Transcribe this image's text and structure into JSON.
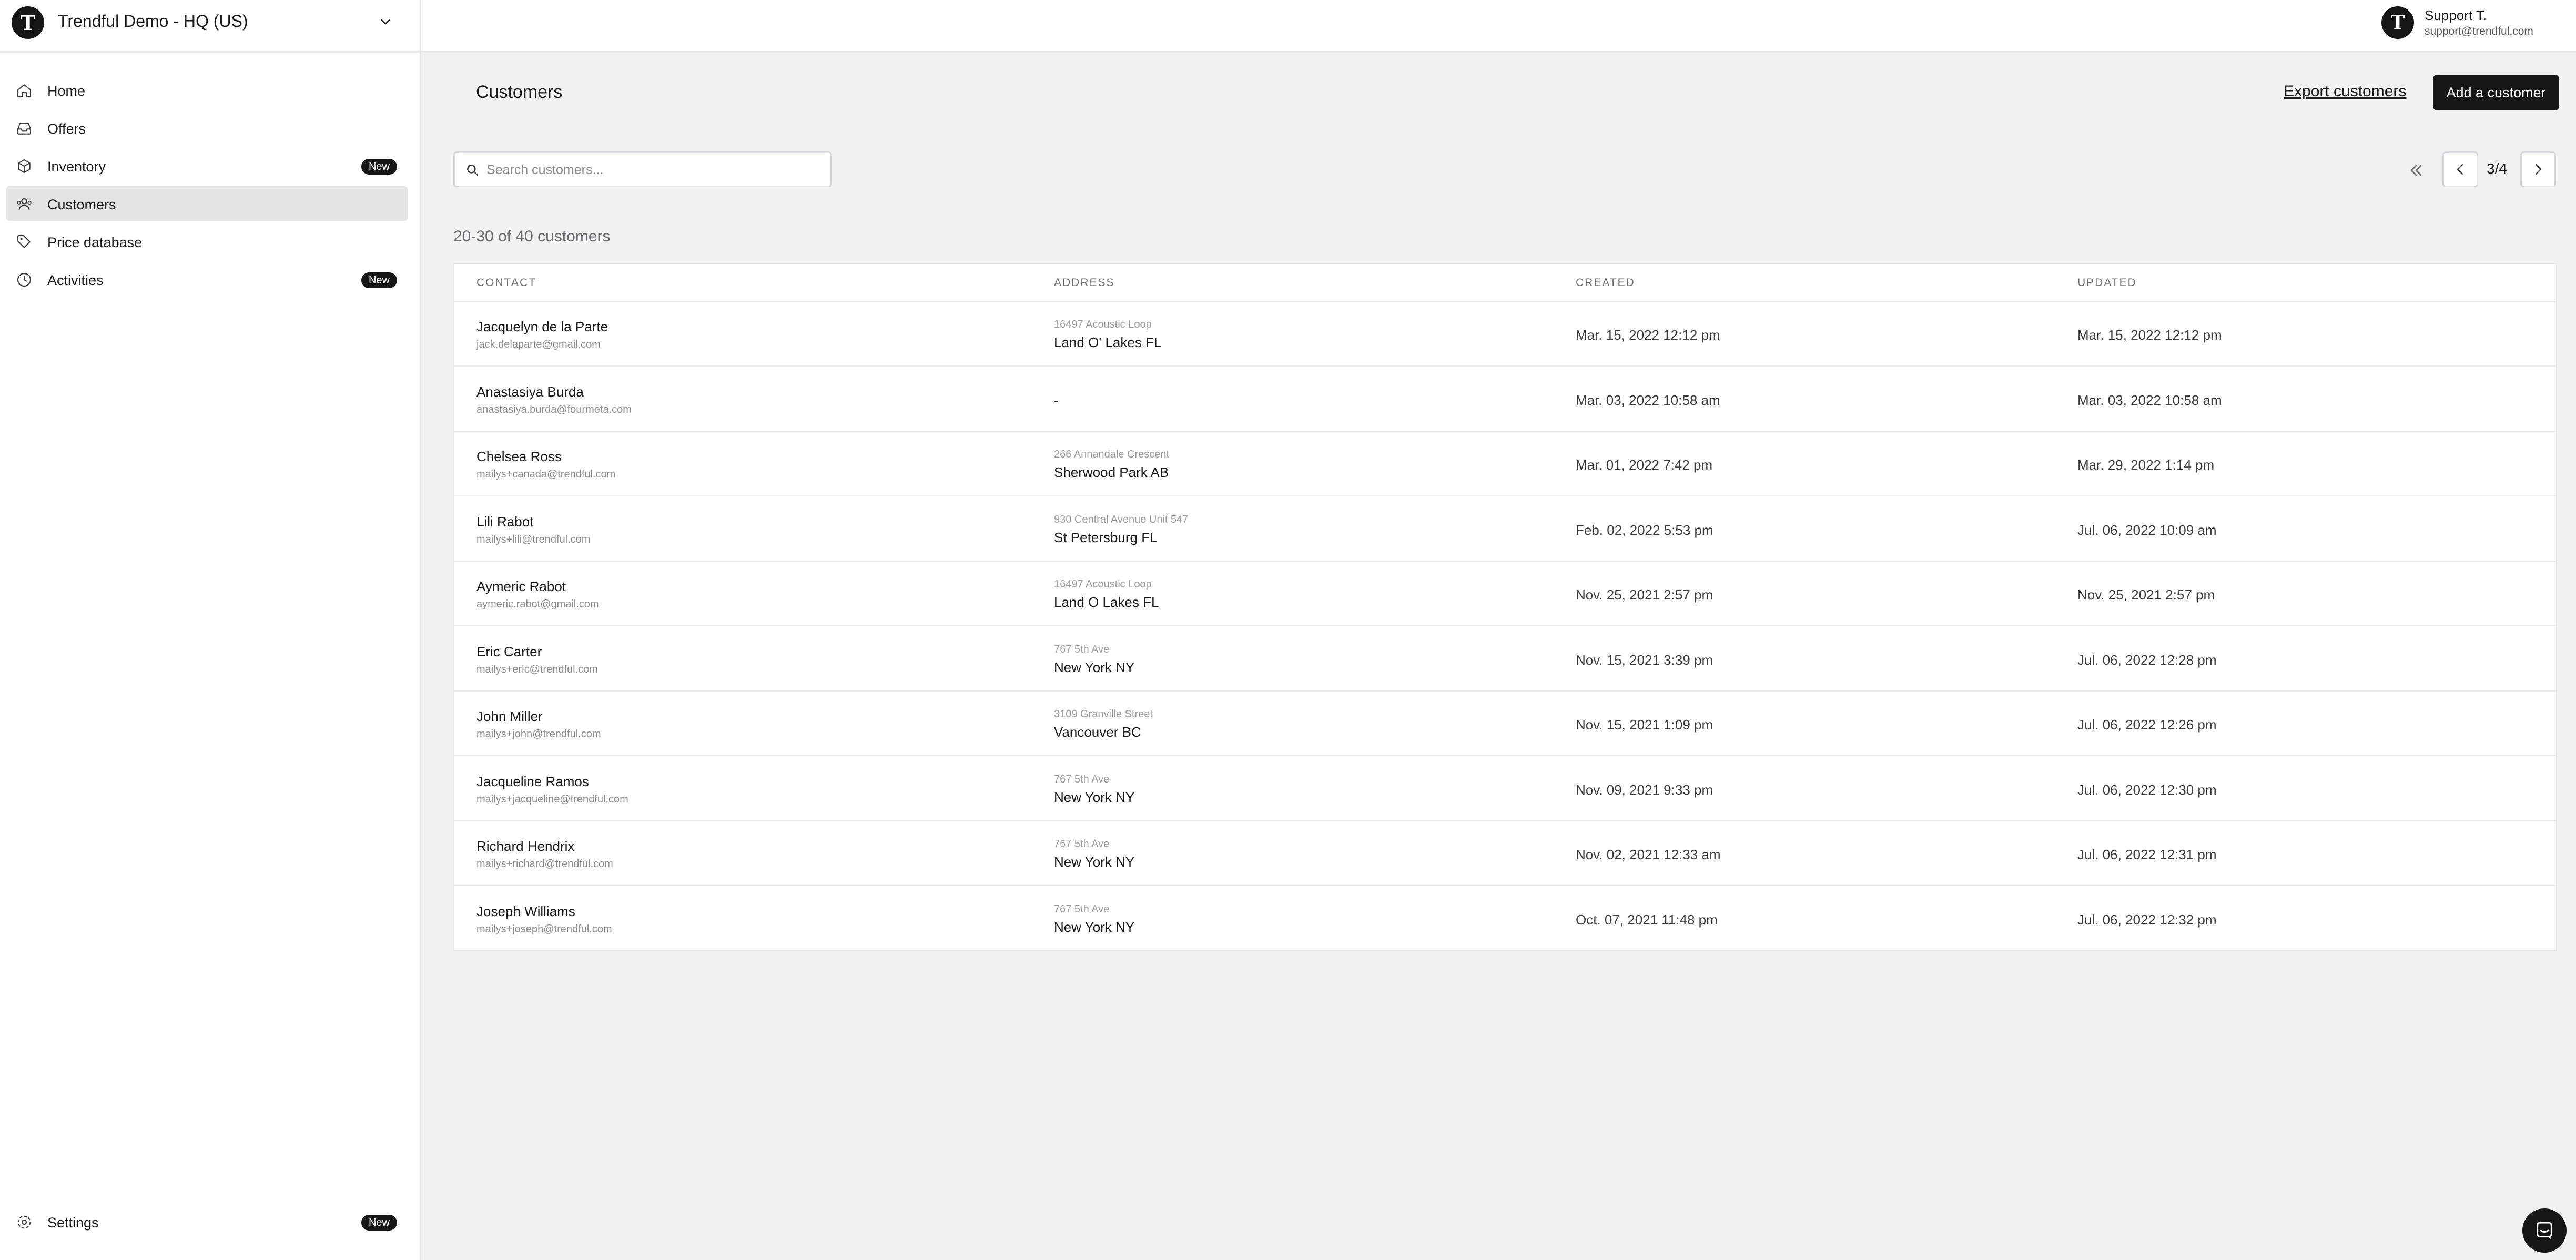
{
  "org": {
    "initial": "T",
    "name": "Trendful Demo - HQ (US)"
  },
  "nav": [
    {
      "label": "Home",
      "icon": "home-icon",
      "badge": ""
    },
    {
      "label": "Offers",
      "icon": "inbox-icon",
      "badge": ""
    },
    {
      "label": "Inventory",
      "icon": "box-icon",
      "badge": "New"
    },
    {
      "label": "Customers",
      "icon": "users-icon",
      "badge": "",
      "active": true
    },
    {
      "label": "Price database",
      "icon": "tag-icon",
      "badge": ""
    },
    {
      "label": "Activities",
      "icon": "clock-icon",
      "badge": "New"
    }
  ],
  "settings": {
    "label": "Settings",
    "icon": "gear-icon",
    "badge": "New"
  },
  "user": {
    "initial": "T",
    "name": "Support T.",
    "email": "support@trendful.com"
  },
  "page": {
    "title": "Customers",
    "export_label": "Export customers",
    "add_label": "Add a customer",
    "search_placeholder": "Search customers...",
    "pagination": "3/4",
    "count_text": "20-30 of 40 customers"
  },
  "table": {
    "headers": [
      "CONTACT",
      "ADDRESS",
      "CREATED",
      "UPDATED"
    ],
    "rows": [
      {
        "name": "Jacquelyn de la Parte",
        "email": "jack.delaparte@gmail.com",
        "street": "16497 Acoustic Loop",
        "city": "Land O' Lakes FL",
        "created": "Mar. 15, 2022 12:12 pm",
        "updated": "Mar. 15, 2022 12:12 pm"
      },
      {
        "name": "Anastasiya Burda",
        "email": "anastasiya.burda@fourmeta.com",
        "street": "",
        "city": "-",
        "created": "Mar. 03, 2022 10:58 am",
        "updated": "Mar. 03, 2022 10:58 am"
      },
      {
        "name": "Chelsea Ross",
        "email": "mailys+canada@trendful.com",
        "street": "266 Annandale Crescent",
        "city": "Sherwood Park AB",
        "created": "Mar. 01, 2022 7:42 pm",
        "updated": "Mar. 29, 2022 1:14 pm"
      },
      {
        "name": "Lili Rabot",
        "email": "mailys+lili@trendful.com",
        "street": "930 Central Avenue Unit 547",
        "city": "St Petersburg FL",
        "created": "Feb. 02, 2022 5:53 pm",
        "updated": "Jul. 06, 2022 10:09 am"
      },
      {
        "name": "Aymeric Rabot",
        "email": "aymeric.rabot@gmail.com",
        "street": "16497 Acoustic Loop",
        "city": "Land O Lakes FL",
        "created": "Nov. 25, 2021 2:57 pm",
        "updated": "Nov. 25, 2021 2:57 pm"
      },
      {
        "name": "Eric Carter",
        "email": "mailys+eric@trendful.com",
        "street": "767 5th Ave",
        "city": "New York NY",
        "created": "Nov. 15, 2021 3:39 pm",
        "updated": "Jul. 06, 2022 12:28 pm"
      },
      {
        "name": "John Miller",
        "email": "mailys+john@trendful.com",
        "street": "3109 Granville Street",
        "city": "Vancouver BC",
        "created": "Nov. 15, 2021 1:09 pm",
        "updated": "Jul. 06, 2022 12:26 pm"
      },
      {
        "name": "Jacqueline Ramos",
        "email": "mailys+jacqueline@trendful.com",
        "street": "767 5th Ave",
        "city": "New York NY",
        "created": "Nov. 09, 2021 9:33 pm",
        "updated": "Jul. 06, 2022 12:30 pm"
      },
      {
        "name": "Richard Hendrix",
        "email": "mailys+richard@trendful.com",
        "street": "767 5th Ave",
        "city": "New York NY",
        "created": "Nov. 02, 2021 12:33 am",
        "updated": "Jul. 06, 2022 12:31 pm"
      },
      {
        "name": "Joseph Williams",
        "email": "mailys+joseph@trendful.com",
        "street": "767 5th Ave",
        "city": "New York NY",
        "created": "Oct. 07, 2021 11:48 pm",
        "updated": "Jul. 06, 2022 12:32 pm"
      }
    ]
  },
  "colors": {
    "accent": "#161616",
    "background": "#f1f1f2",
    "active_nav": "#e4e4e6"
  }
}
